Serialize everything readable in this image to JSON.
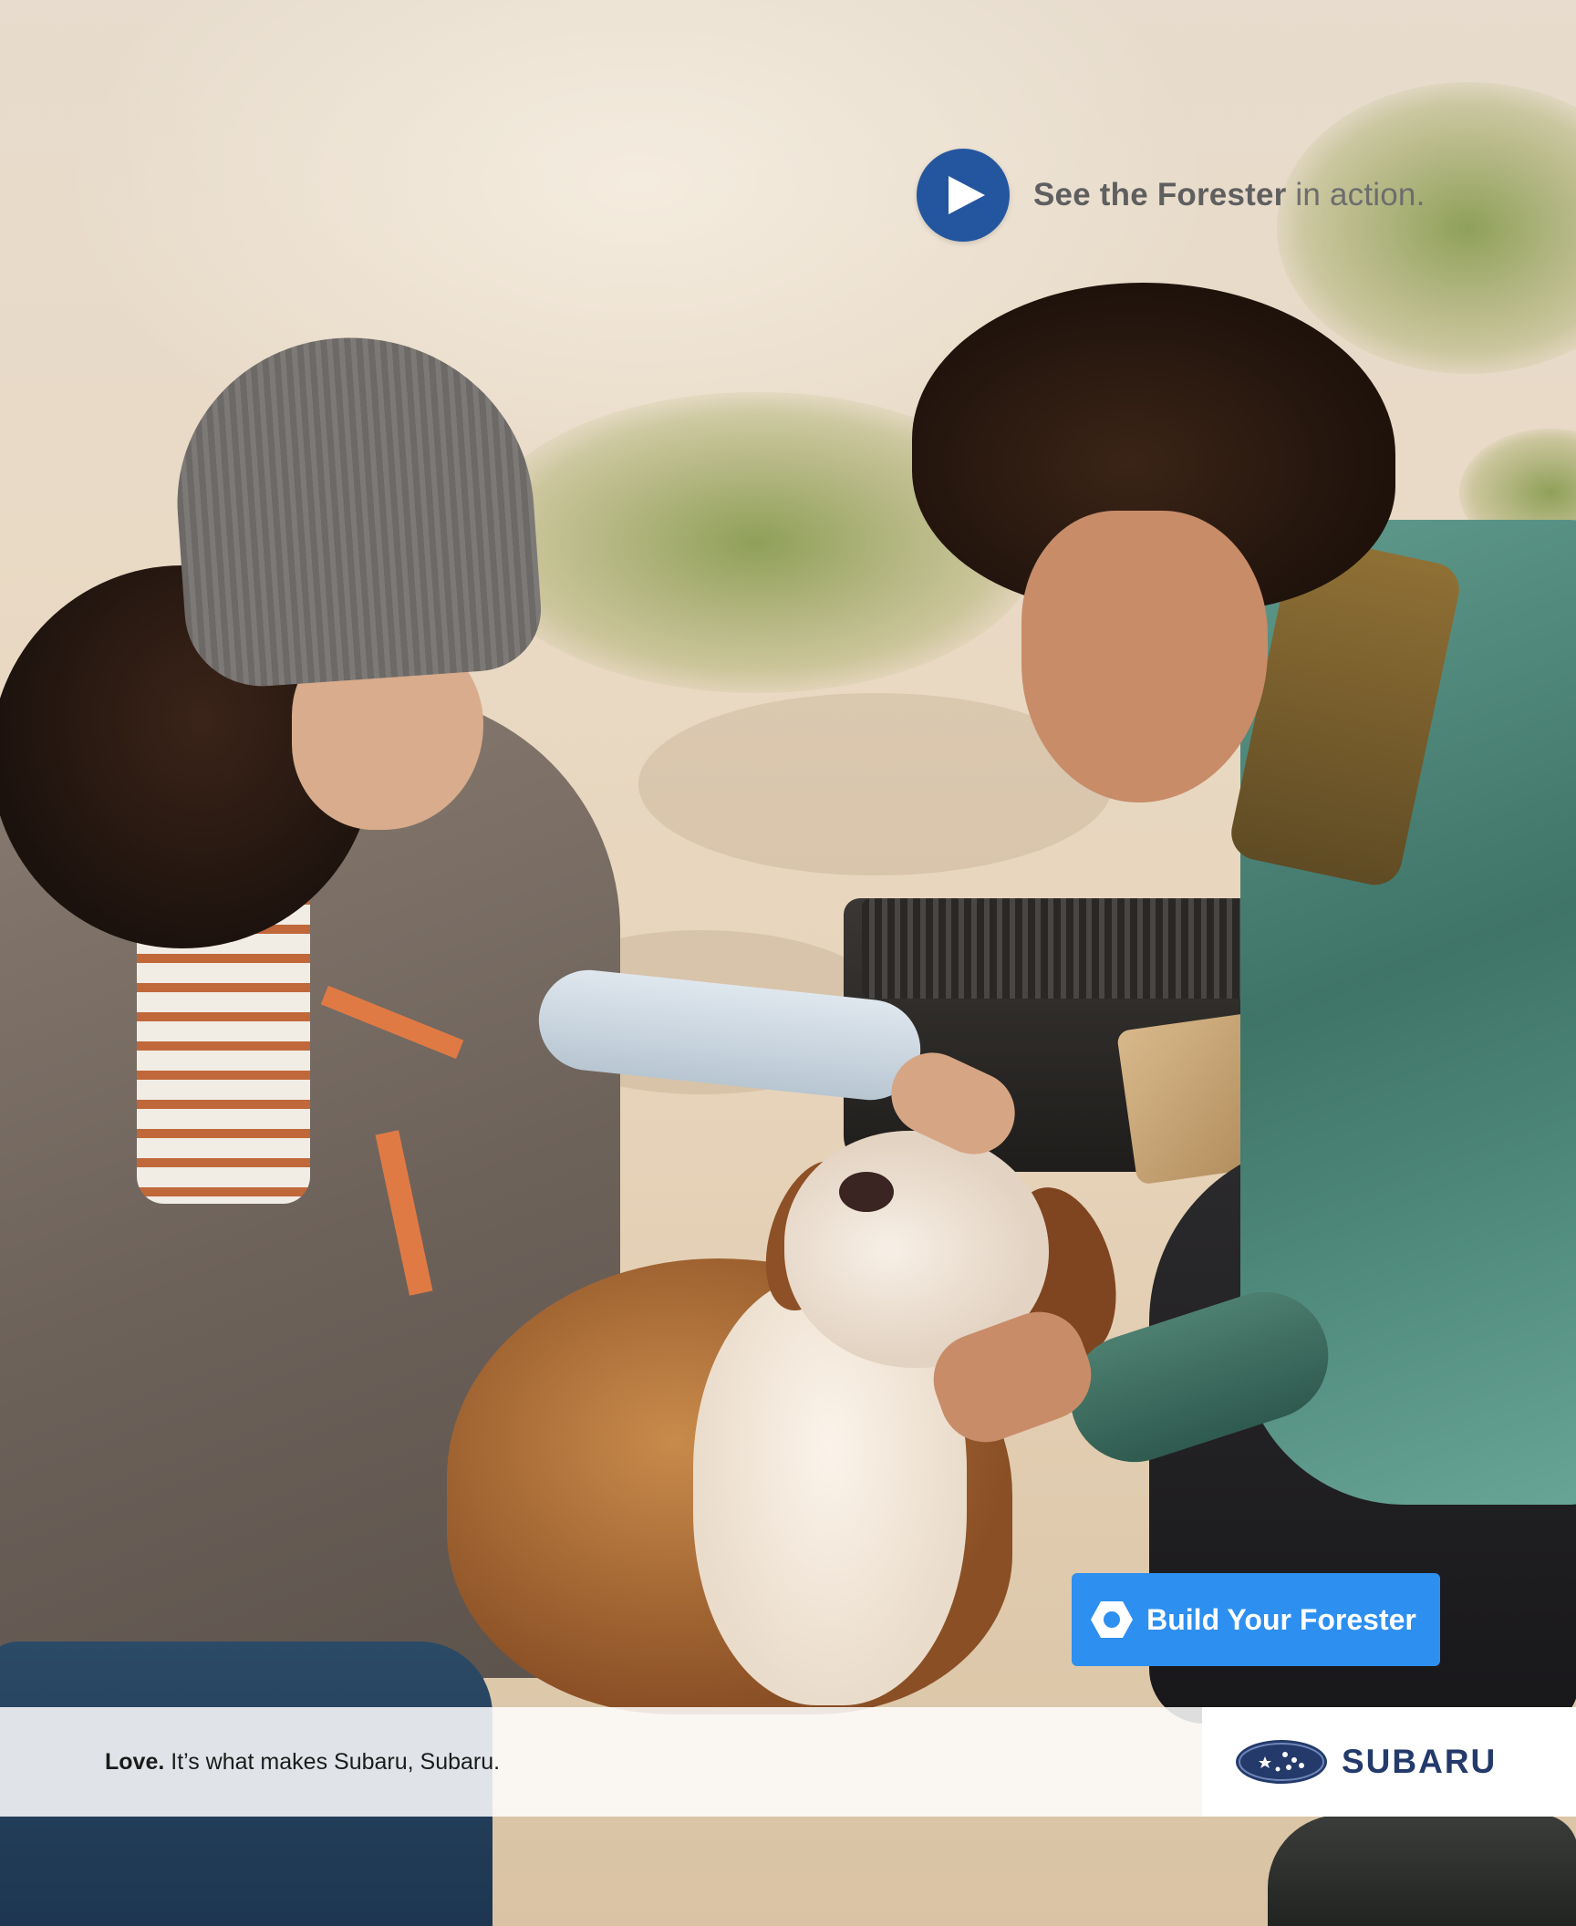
{
  "video_cta": {
    "bold_text": "See the Forester",
    "rest_text": " in action.",
    "icon": "play-icon"
  },
  "build_button": {
    "label": "Build Your Forester",
    "icon": "hexagon-icon"
  },
  "footer": {
    "tagline_bold": "Love.",
    "tagline_rest": " It’s what makes Subaru, Subaru.",
    "brand": "SUBARU"
  },
  "colors": {
    "play_button": "#2456a0",
    "build_button": "#2d8ff0",
    "brand_navy": "#233a6b"
  }
}
